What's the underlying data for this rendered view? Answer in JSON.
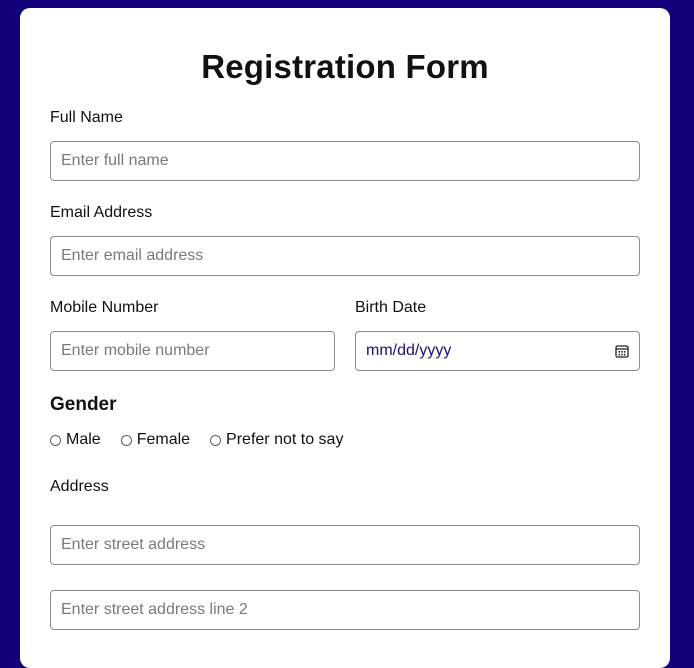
{
  "form": {
    "title": "Registration Form",
    "full_name": {
      "label": "Full Name",
      "placeholder": "Enter full name"
    },
    "email": {
      "label": "Email Address",
      "placeholder": "Enter email address"
    },
    "mobile": {
      "label": "Mobile Number",
      "placeholder": "Enter mobile number"
    },
    "birth_date": {
      "label": "Birth Date",
      "placeholder": "mm/dd/yyyy",
      "icon": "calendar-icon"
    },
    "gender": {
      "heading": "Gender",
      "options": [
        "Male",
        "Female",
        "Prefer not to say"
      ]
    },
    "address": {
      "label": "Address",
      "line1_placeholder": "Enter street address",
      "line2_placeholder": "Enter street address line 2"
    }
  },
  "colors": {
    "background": "#12007a",
    "card": "#ffffff",
    "date_text": "#1a1270"
  }
}
